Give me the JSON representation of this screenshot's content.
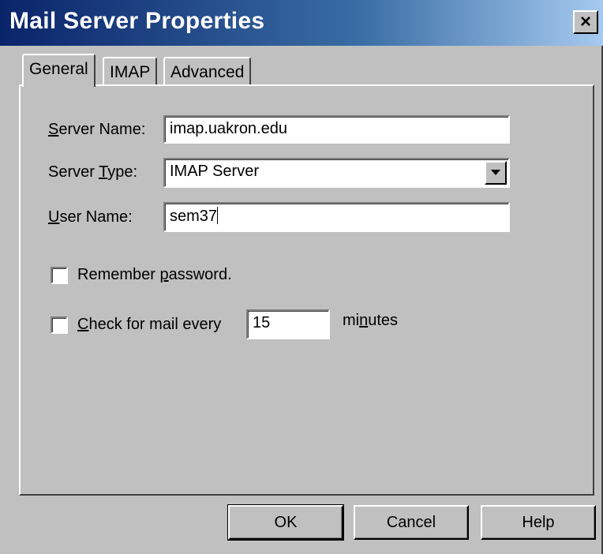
{
  "window": {
    "title": "Mail Server Properties",
    "close_label": "×"
  },
  "tabs": [
    {
      "label": "General",
      "active": true
    },
    {
      "label": "IMAP",
      "active": false
    },
    {
      "label": "Advanced",
      "active": false
    }
  ],
  "general": {
    "server_name": {
      "label_underlined": "S",
      "label_rest": "erver Name:",
      "value": "imap.uakron.edu"
    },
    "server_type": {
      "label_prefix": "Server ",
      "label_underlined": "T",
      "label_rest": "ype:",
      "value": "IMAP Server"
    },
    "user_name": {
      "label_underlined": "U",
      "label_rest": "ser Name:",
      "value": "sem37"
    },
    "remember_password": {
      "label_prefix": "Remember ",
      "label_underlined": "p",
      "label_rest": "assword.",
      "checked": false
    },
    "check_mail": {
      "label_underlined": "C",
      "label_rest": "heck for mail every",
      "checked": false,
      "value": "15",
      "unit_prefix": "mi",
      "unit_underlined": "n",
      "unit_rest": "utes"
    }
  },
  "buttons": {
    "ok": "OK",
    "cancel": "Cancel",
    "help": "Help"
  },
  "colors": {
    "title_start": "#0a246a",
    "title_end": "#a6caf0",
    "face": "#c0c0c0"
  },
  "icons": {
    "close": "close-icon",
    "dropdown": "chevron-down-icon"
  }
}
